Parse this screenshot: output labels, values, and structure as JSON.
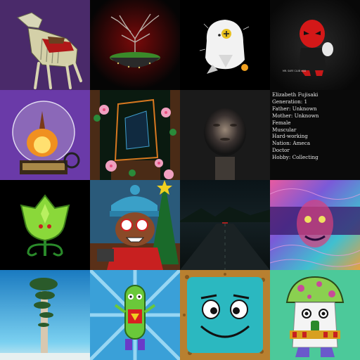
{
  "gallery": {
    "tiles": [
      {
        "name": "skeleton-horse-tile",
        "caption": ""
      },
      {
        "name": "bonsai-tree-island-tile",
        "caption": ""
      },
      {
        "name": "white-bird-toy-tile",
        "caption": ""
      },
      {
        "name": "red-masked-figure-tile",
        "caption": "MR. SAFE CLUB #00",
        "sub_caption": ""
      },
      {
        "name": "snow-globe-fire-tile",
        "caption": ""
      },
      {
        "name": "flower-frame-collage-tile",
        "caption": ""
      },
      {
        "name": "blurred-face-tile",
        "caption": ""
      },
      {
        "name": "character-bio-tile",
        "caption": ""
      },
      {
        "name": "green-bud-creature-tile",
        "caption": ""
      },
      {
        "name": "christmas-elf-tile",
        "caption": ""
      },
      {
        "name": "dark-road-tile",
        "caption": ""
      },
      {
        "name": "psychedelic-face-tile",
        "caption": ""
      },
      {
        "name": "tall-tree-sky-tile",
        "caption": ""
      },
      {
        "name": "green-pickle-hero-tile",
        "caption": ""
      },
      {
        "name": "teal-square-face-tile",
        "caption": ""
      },
      {
        "name": "mushroom-creature-tile",
        "caption": ""
      }
    ],
    "bio": {
      "lines": [
        "Elizabeth Fujisaki",
        "Generation: 1",
        "Father: Unknown",
        "Mother: Unknown",
        "Female",
        "Muscular",
        "Hard-working",
        "Nation: Ameca",
        "Doctor",
        "Hobby: Collecting"
      ]
    },
    "colors": {
      "purple_bg": "#4a2a6a",
      "red_glow": "#7a0a0a",
      "teal_face": "#2bb8c0",
      "mint_bg": "#4cc99a",
      "sky_blue": "#3aa0d8"
    }
  }
}
